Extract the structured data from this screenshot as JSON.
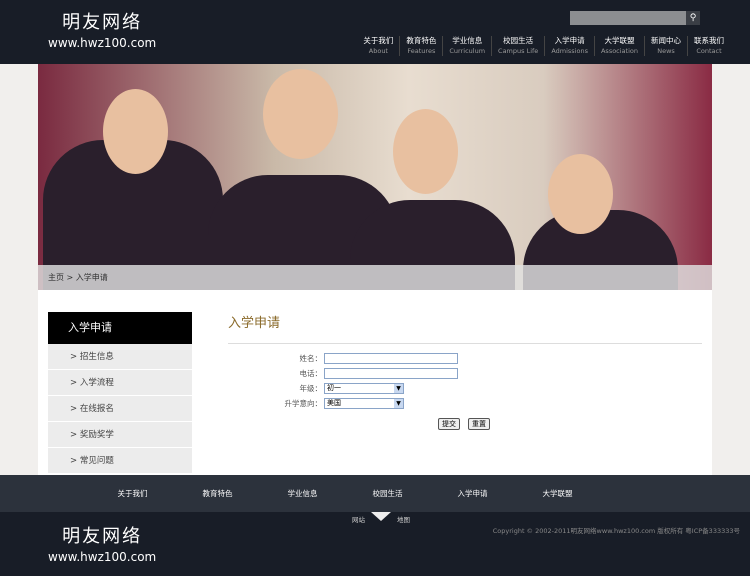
{
  "site": {
    "name_cn": "明友网络",
    "domain": "www.hwz100.com"
  },
  "search": {
    "placeholder": ""
  },
  "nav": [
    {
      "cn": "关于我们",
      "en": "About"
    },
    {
      "cn": "教育特色",
      "en": "Features"
    },
    {
      "cn": "学业信息",
      "en": "Curriculum"
    },
    {
      "cn": "校园生活",
      "en": "Campus Life"
    },
    {
      "cn": "入学申请",
      "en": "Admissions"
    },
    {
      "cn": "大学联盟",
      "en": "Association"
    },
    {
      "cn": "新闻中心",
      "en": "News"
    },
    {
      "cn": "联系我们",
      "en": "Contact"
    }
  ],
  "breadcrumb": "主页 > 入学申请",
  "sidebar": {
    "title": "入学申请",
    "items": [
      "> 招生信息",
      "> 入学流程",
      "> 在线报名",
      "> 奖励奖学",
      "> 常见问题"
    ]
  },
  "form": {
    "title": "入学申请",
    "name_label": "姓名：",
    "phone_label": "电话：",
    "grade_label": "年级：",
    "grade_value": "初一",
    "intent_label": "升学意向：",
    "intent_value": "美国",
    "submit": "提交",
    "reset": "重置"
  },
  "footer": {
    "nav": [
      "关于我们",
      "教育特色",
      "学业信息",
      "校园生活",
      "入学申请",
      "大学联盟"
    ],
    "sitemap_left": "网站",
    "sitemap_right": "地图",
    "copyright": "Copyright © 2002-2011明友网络www.hwz100.com 版权所有 粤ICP备333333号"
  }
}
